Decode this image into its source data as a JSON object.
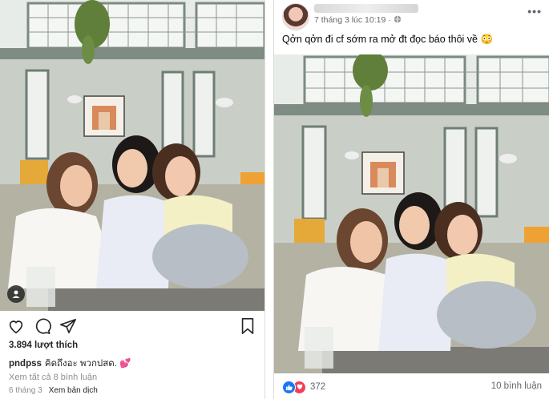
{
  "instagram": {
    "likes": "3.894 lượt thích",
    "username": "pndpss",
    "caption": "คิดถึงอะ พวกปสด. 💕",
    "view_comments": "Xem tất cả 8 bình luận",
    "date": "6 tháng 3",
    "translate": "Xem bản dịch",
    "icons": [
      "heart-icon",
      "comment-icon",
      "share-icon",
      "bookmark-icon",
      "user-tag-icon"
    ]
  },
  "facebook": {
    "timestamp": "7 tháng 3 lúc 10:19 · ",
    "privacy_icon": "globe-icon",
    "more": "•••",
    "post_text": "Qởn qởn đi cf sớm ra mở đt đọc báo thôi về 😳",
    "reaction_count": "372",
    "comments": "10 bình luận",
    "reactions": [
      "like-icon",
      "love-icon"
    ]
  },
  "colors": {
    "fb_blue": "#1877f2",
    "fb_love": "#f33e58",
    "text_dark": "#262626",
    "text_muted": "#8e8e8e"
  }
}
